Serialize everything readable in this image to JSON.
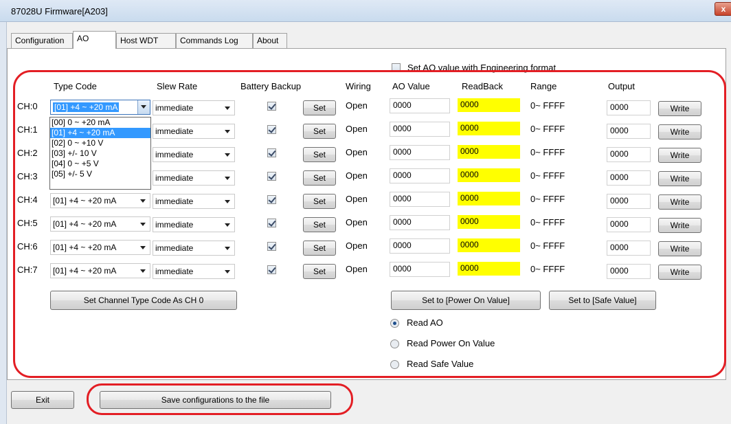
{
  "window": {
    "title": "87028U Firmware[A203]",
    "close": "x"
  },
  "tabs": [
    "Configuration",
    "AO",
    "Host WDT",
    "Commands Log",
    "About"
  ],
  "eng_format_label": "Set AO value with Engineering format",
  "headers": {
    "type_code": "Type Code",
    "slew_rate": "Slew Rate",
    "battery_backup": "Battery Backup",
    "wiring": "Wiring",
    "ao_value": "AO Value",
    "readback": "ReadBack",
    "range": "Range",
    "output": "Output"
  },
  "channels": [
    {
      "ch": "CH:0",
      "type": "[01] +4 ~ +20 mA",
      "slew": "immediate",
      "backup": true,
      "set": "Set",
      "wiring": "Open",
      "ao": "0000",
      "readback": "0000",
      "range": "0~ FFFF",
      "output": "0000",
      "write": "Write"
    },
    {
      "ch": "CH:1",
      "type": "[01] +4 ~ +20 mA",
      "slew": "immediate",
      "backup": true,
      "set": "Set",
      "wiring": "Open",
      "ao": "0000",
      "readback": "0000",
      "range": "0~ FFFF",
      "output": "0000",
      "write": "Write"
    },
    {
      "ch": "CH:2",
      "type": "[01] +4 ~ +20 mA",
      "slew": "immediate",
      "backup": true,
      "set": "Set",
      "wiring": "Open",
      "ao": "0000",
      "readback": "0000",
      "range": "0~ FFFF",
      "output": "0000",
      "write": "Write"
    },
    {
      "ch": "CH:3",
      "type": "[01] +4 ~ +20 mA",
      "slew": "immediate",
      "backup": true,
      "set": "Set",
      "wiring": "Open",
      "ao": "0000",
      "readback": "0000",
      "range": "0~ FFFF",
      "output": "0000",
      "write": "Write"
    },
    {
      "ch": "CH:4",
      "type": "[01] +4 ~ +20 mA",
      "slew": "immediate",
      "backup": true,
      "set": "Set",
      "wiring": "Open",
      "ao": "0000",
      "readback": "0000",
      "range": "0~ FFFF",
      "output": "0000",
      "write": "Write"
    },
    {
      "ch": "CH:5",
      "type": "[01] +4 ~ +20 mA",
      "slew": "immediate",
      "backup": true,
      "set": "Set",
      "wiring": "Open",
      "ao": "0000",
      "readback": "0000",
      "range": "0~ FFFF",
      "output": "0000",
      "write": "Write"
    },
    {
      "ch": "CH:6",
      "type": "[01] +4 ~ +20 mA",
      "slew": "immediate",
      "backup": true,
      "set": "Set",
      "wiring": "Open",
      "ao": "0000",
      "readback": "0000",
      "range": "0~ FFFF",
      "output": "0000",
      "write": "Write"
    },
    {
      "ch": "CH:7",
      "type": "[01] +4 ~ +20 mA",
      "slew": "immediate",
      "backup": true,
      "set": "Set",
      "wiring": "Open",
      "ao": "0000",
      "readback": "0000",
      "range": "0~ FFFF",
      "output": "0000",
      "write": "Write"
    }
  ],
  "type_options": [
    "[00] 0 ~ +20 mA",
    "[01] +4 ~ +20 mA",
    "[02] 0 ~ +10 V",
    "[03] +/- 10 V",
    "[04] 0 ~ +5 V",
    "[05] +/- 5 V"
  ],
  "buttons": {
    "set_channel_type": "Set Channel Type Code As CH 0",
    "set_power_on": "Set to [Power On Value]",
    "set_safe": "Set to [Safe Value]",
    "exit": "Exit",
    "save": "Save configurations to the file"
  },
  "radios": [
    {
      "label": "Read AO",
      "checked": true
    },
    {
      "label": "Read Power On Value",
      "checked": false
    },
    {
      "label": "Read Safe Value",
      "checked": false
    }
  ],
  "colors": {
    "readback_bg": "#ffff00",
    "annotation_red": "#e31e24",
    "selection": "#3399ff"
  }
}
